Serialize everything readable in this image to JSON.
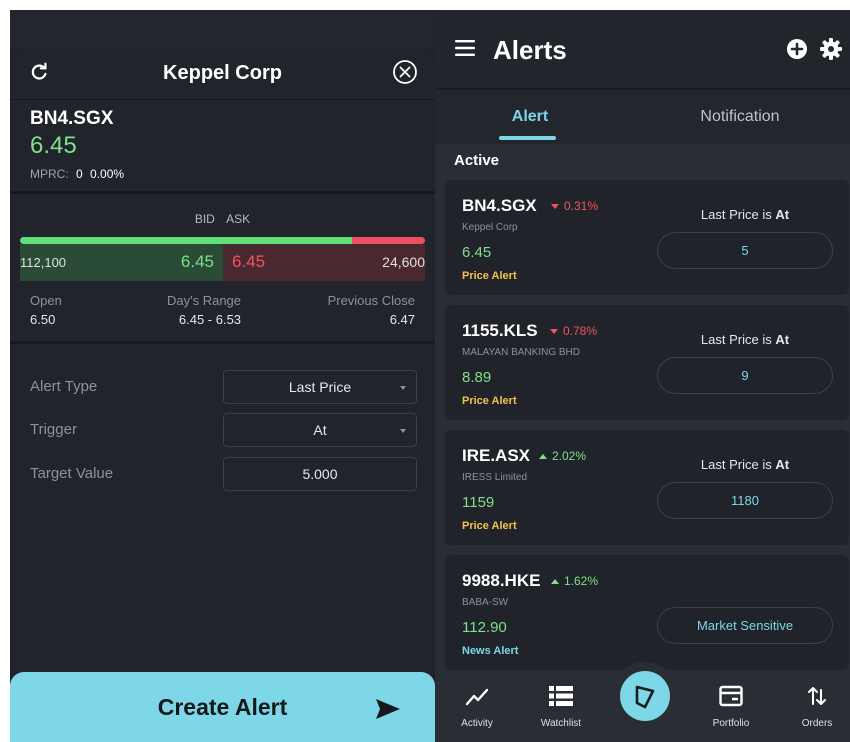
{
  "left": {
    "title": "Keppel Corp",
    "symbol": "BN4.SGX",
    "price": "6.45",
    "mprc_label": "MPRC:",
    "mprc_value": "0",
    "mprc_pct": "0.00%",
    "bid_label": "BID",
    "ask_label": "ASK",
    "bid_qty": "112,100",
    "bid_price": "6.45",
    "ask_price": "6.45",
    "ask_qty": "24,600",
    "bid_share": 0.82,
    "stats": {
      "open_label": "Open",
      "open_value": "6.50",
      "range_label": "Day's Range",
      "range_value": "6.45 - 6.53",
      "prev_label": "Previous Close",
      "prev_value": "6.47"
    },
    "form": {
      "alert_type_label": "Alert Type",
      "alert_type_value": "Last Price",
      "trigger_label": "Trigger",
      "trigger_value": "At",
      "target_label": "Target Value",
      "target_value": "5.000"
    },
    "create_label": "Create Alert"
  },
  "right": {
    "title": "Alerts",
    "tabs": [
      "Alert",
      "Notification"
    ],
    "section": "Active",
    "alerts": [
      {
        "symbol": "BN4.SGX",
        "change": "0.31%",
        "direction": "down",
        "name": "Keppel Corp",
        "price": "6.45",
        "type": "Price Alert",
        "cond_prefix": "Last Price is",
        "cond_op": "At",
        "value": "5"
      },
      {
        "symbol": "1155.KLS",
        "change": "0.78%",
        "direction": "down",
        "name": "MALAYAN BANKING BHD",
        "price": "8.89",
        "type": "Price Alert",
        "cond_prefix": "Last Price is",
        "cond_op": "At",
        "value": "9"
      },
      {
        "symbol": "IRE.ASX",
        "change": "2.02%",
        "direction": "up",
        "name": "IRESS Limited",
        "price": "1159",
        "type": "Price Alert",
        "cond_prefix": "Last Price is",
        "cond_op": "At",
        "value": "1180"
      },
      {
        "symbol": "9988.HKE",
        "change": "1.62%",
        "direction": "up",
        "name": "BABA-SW",
        "price": "112.90",
        "type": "News Alert",
        "cond_prefix": "",
        "cond_op": "",
        "value": "Market Sensitive"
      }
    ],
    "nav": [
      "Activity",
      "Watchlist",
      "Portfolio",
      "Orders"
    ]
  },
  "colors": {
    "accent": "#7dd7e6",
    "positive": "#7ee08a",
    "negative": "#f0555f",
    "price_alert": "#f3c24a"
  },
  "icons": [
    "refresh-icon",
    "close-circle-icon",
    "send-icon",
    "menu-icon",
    "add-circle-icon",
    "gear-icon",
    "activity-icon",
    "watchlist-icon",
    "search-compass-icon",
    "portfolio-icon",
    "orders-icon"
  ]
}
